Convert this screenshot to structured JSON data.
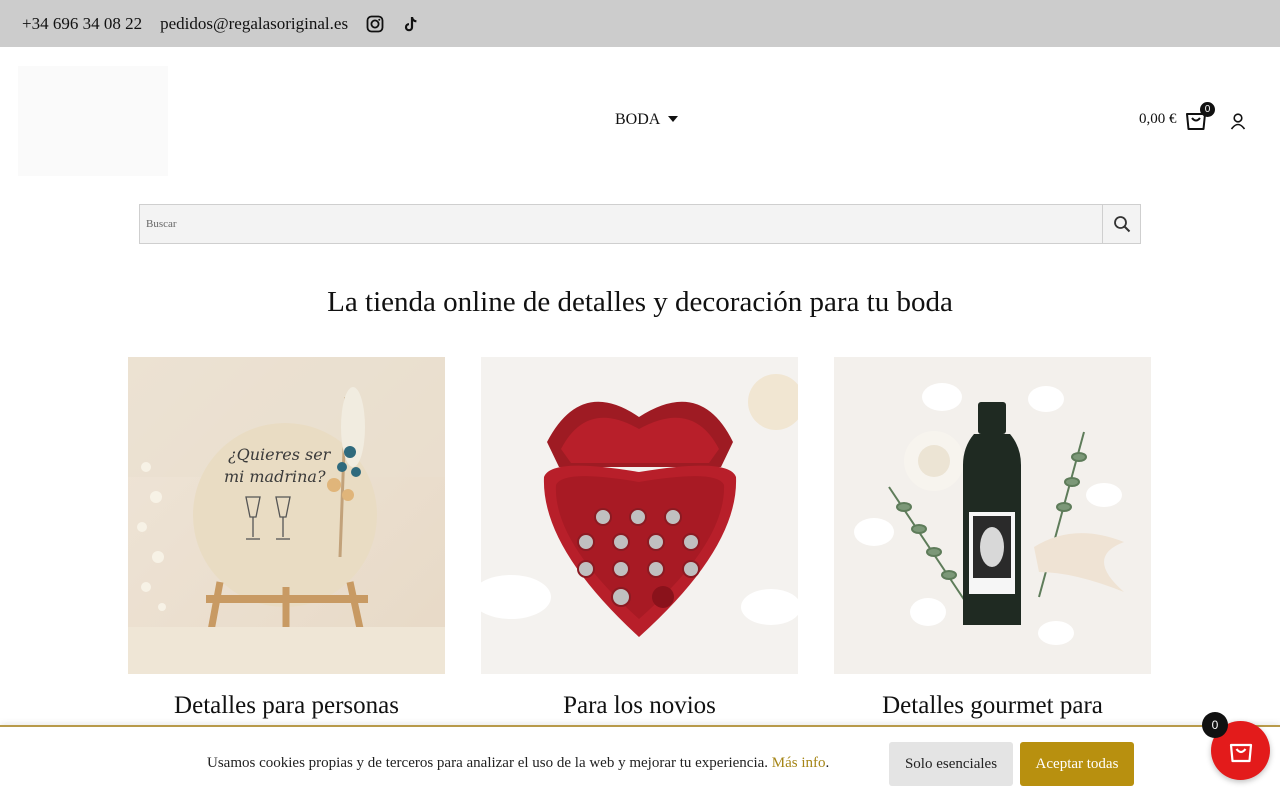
{
  "topbar": {
    "phone": "+34 696 34 08 22",
    "email": "pedidos@regalasoriginal.es",
    "icons": [
      "instagram-icon",
      "tiktok-icon"
    ]
  },
  "header": {
    "nav_item": "BODA",
    "cart_total": "0,00 €",
    "cart_count": "0"
  },
  "search": {
    "placeholder": "Buscar"
  },
  "main": {
    "headline": "La tienda online de detalles y decoración para tu boda",
    "categories": [
      {
        "title": "Detalles para personas",
        "image_caption_1": "¿Quieres ser",
        "image_caption_2": "mi madrina?"
      },
      {
        "title": "Para los novios"
      },
      {
        "title": "Detalles gourmet para"
      }
    ]
  },
  "cookie": {
    "message": "Usamos cookies propias y de terceros para analizar el uso de la web y mejorar tu experiencia.",
    "more_link": "Más info",
    "essentials_label": "Solo esenciales",
    "accept_label": "Aceptar todas"
  },
  "floating_cart": {
    "count": "0"
  },
  "colors": {
    "topbar_bg": "#cccccc",
    "accent_gold": "#b8900f",
    "fab_red": "#e31b1b"
  }
}
